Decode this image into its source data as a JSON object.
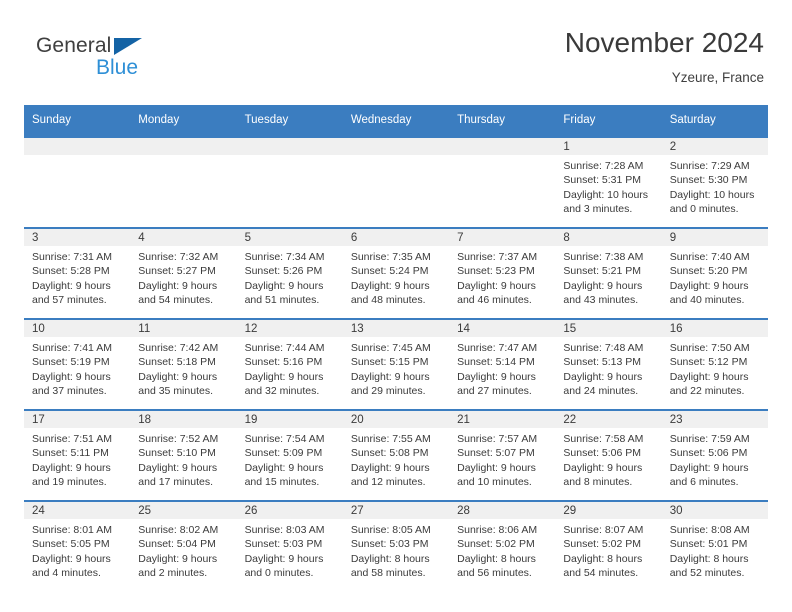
{
  "brand": {
    "word1": "General",
    "word2": "Blue",
    "triangle_icon": "brand-triangle-icon",
    "accent_dark": "#1463a5",
    "accent_light": "#2e8fd6"
  },
  "header": {
    "month_title": "November 2024",
    "location": "Yzeure, France"
  },
  "colors": {
    "header_blue": "#3b7dc0",
    "day_band_gray": "#f0f0f0",
    "text": "#3b3b3b"
  },
  "weekday_headers": [
    "Sunday",
    "Monday",
    "Tuesday",
    "Wednesday",
    "Thursday",
    "Friday",
    "Saturday"
  ],
  "weeks": [
    [
      {
        "day": "",
        "sunrise": "",
        "sunset": "",
        "daylight1": "",
        "daylight2": ""
      },
      {
        "day": "",
        "sunrise": "",
        "sunset": "",
        "daylight1": "",
        "daylight2": ""
      },
      {
        "day": "",
        "sunrise": "",
        "sunset": "",
        "daylight1": "",
        "daylight2": ""
      },
      {
        "day": "",
        "sunrise": "",
        "sunset": "",
        "daylight1": "",
        "daylight2": ""
      },
      {
        "day": "",
        "sunrise": "",
        "sunset": "",
        "daylight1": "",
        "daylight2": ""
      },
      {
        "day": "1",
        "sunrise": "Sunrise: 7:28 AM",
        "sunset": "Sunset: 5:31 PM",
        "daylight1": "Daylight: 10 hours",
        "daylight2": "and 3 minutes."
      },
      {
        "day": "2",
        "sunrise": "Sunrise: 7:29 AM",
        "sunset": "Sunset: 5:30 PM",
        "daylight1": "Daylight: 10 hours",
        "daylight2": "and 0 minutes."
      }
    ],
    [
      {
        "day": "3",
        "sunrise": "Sunrise: 7:31 AM",
        "sunset": "Sunset: 5:28 PM",
        "daylight1": "Daylight: 9 hours",
        "daylight2": "and 57 minutes."
      },
      {
        "day": "4",
        "sunrise": "Sunrise: 7:32 AM",
        "sunset": "Sunset: 5:27 PM",
        "daylight1": "Daylight: 9 hours",
        "daylight2": "and 54 minutes."
      },
      {
        "day": "5",
        "sunrise": "Sunrise: 7:34 AM",
        "sunset": "Sunset: 5:26 PM",
        "daylight1": "Daylight: 9 hours",
        "daylight2": "and 51 minutes."
      },
      {
        "day": "6",
        "sunrise": "Sunrise: 7:35 AM",
        "sunset": "Sunset: 5:24 PM",
        "daylight1": "Daylight: 9 hours",
        "daylight2": "and 48 minutes."
      },
      {
        "day": "7",
        "sunrise": "Sunrise: 7:37 AM",
        "sunset": "Sunset: 5:23 PM",
        "daylight1": "Daylight: 9 hours",
        "daylight2": "and 46 minutes."
      },
      {
        "day": "8",
        "sunrise": "Sunrise: 7:38 AM",
        "sunset": "Sunset: 5:21 PM",
        "daylight1": "Daylight: 9 hours",
        "daylight2": "and 43 minutes."
      },
      {
        "day": "9",
        "sunrise": "Sunrise: 7:40 AM",
        "sunset": "Sunset: 5:20 PM",
        "daylight1": "Daylight: 9 hours",
        "daylight2": "and 40 minutes."
      }
    ],
    [
      {
        "day": "10",
        "sunrise": "Sunrise: 7:41 AM",
        "sunset": "Sunset: 5:19 PM",
        "daylight1": "Daylight: 9 hours",
        "daylight2": "and 37 minutes."
      },
      {
        "day": "11",
        "sunrise": "Sunrise: 7:42 AM",
        "sunset": "Sunset: 5:18 PM",
        "daylight1": "Daylight: 9 hours",
        "daylight2": "and 35 minutes."
      },
      {
        "day": "12",
        "sunrise": "Sunrise: 7:44 AM",
        "sunset": "Sunset: 5:16 PM",
        "daylight1": "Daylight: 9 hours",
        "daylight2": "and 32 minutes."
      },
      {
        "day": "13",
        "sunrise": "Sunrise: 7:45 AM",
        "sunset": "Sunset: 5:15 PM",
        "daylight1": "Daylight: 9 hours",
        "daylight2": "and 29 minutes."
      },
      {
        "day": "14",
        "sunrise": "Sunrise: 7:47 AM",
        "sunset": "Sunset: 5:14 PM",
        "daylight1": "Daylight: 9 hours",
        "daylight2": "and 27 minutes."
      },
      {
        "day": "15",
        "sunrise": "Sunrise: 7:48 AM",
        "sunset": "Sunset: 5:13 PM",
        "daylight1": "Daylight: 9 hours",
        "daylight2": "and 24 minutes."
      },
      {
        "day": "16",
        "sunrise": "Sunrise: 7:50 AM",
        "sunset": "Sunset: 5:12 PM",
        "daylight1": "Daylight: 9 hours",
        "daylight2": "and 22 minutes."
      }
    ],
    [
      {
        "day": "17",
        "sunrise": "Sunrise: 7:51 AM",
        "sunset": "Sunset: 5:11 PM",
        "daylight1": "Daylight: 9 hours",
        "daylight2": "and 19 minutes."
      },
      {
        "day": "18",
        "sunrise": "Sunrise: 7:52 AM",
        "sunset": "Sunset: 5:10 PM",
        "daylight1": "Daylight: 9 hours",
        "daylight2": "and 17 minutes."
      },
      {
        "day": "19",
        "sunrise": "Sunrise: 7:54 AM",
        "sunset": "Sunset: 5:09 PM",
        "daylight1": "Daylight: 9 hours",
        "daylight2": "and 15 minutes."
      },
      {
        "day": "20",
        "sunrise": "Sunrise: 7:55 AM",
        "sunset": "Sunset: 5:08 PM",
        "daylight1": "Daylight: 9 hours",
        "daylight2": "and 12 minutes."
      },
      {
        "day": "21",
        "sunrise": "Sunrise: 7:57 AM",
        "sunset": "Sunset: 5:07 PM",
        "daylight1": "Daylight: 9 hours",
        "daylight2": "and 10 minutes."
      },
      {
        "day": "22",
        "sunrise": "Sunrise: 7:58 AM",
        "sunset": "Sunset: 5:06 PM",
        "daylight1": "Daylight: 9 hours",
        "daylight2": "and 8 minutes."
      },
      {
        "day": "23",
        "sunrise": "Sunrise: 7:59 AM",
        "sunset": "Sunset: 5:06 PM",
        "daylight1": "Daylight: 9 hours",
        "daylight2": "and 6 minutes."
      }
    ],
    [
      {
        "day": "24",
        "sunrise": "Sunrise: 8:01 AM",
        "sunset": "Sunset: 5:05 PM",
        "daylight1": "Daylight: 9 hours",
        "daylight2": "and 4 minutes."
      },
      {
        "day": "25",
        "sunrise": "Sunrise: 8:02 AM",
        "sunset": "Sunset: 5:04 PM",
        "daylight1": "Daylight: 9 hours",
        "daylight2": "and 2 minutes."
      },
      {
        "day": "26",
        "sunrise": "Sunrise: 8:03 AM",
        "sunset": "Sunset: 5:03 PM",
        "daylight1": "Daylight: 9 hours",
        "daylight2": "and 0 minutes."
      },
      {
        "day": "27",
        "sunrise": "Sunrise: 8:05 AM",
        "sunset": "Sunset: 5:03 PM",
        "daylight1": "Daylight: 8 hours",
        "daylight2": "and 58 minutes."
      },
      {
        "day": "28",
        "sunrise": "Sunrise: 8:06 AM",
        "sunset": "Sunset: 5:02 PM",
        "daylight1": "Daylight: 8 hours",
        "daylight2": "and 56 minutes."
      },
      {
        "day": "29",
        "sunrise": "Sunrise: 8:07 AM",
        "sunset": "Sunset: 5:02 PM",
        "daylight1": "Daylight: 8 hours",
        "daylight2": "and 54 minutes."
      },
      {
        "day": "30",
        "sunrise": "Sunrise: 8:08 AM",
        "sunset": "Sunset: 5:01 PM",
        "daylight1": "Daylight: 8 hours",
        "daylight2": "and 52 minutes."
      }
    ]
  ]
}
